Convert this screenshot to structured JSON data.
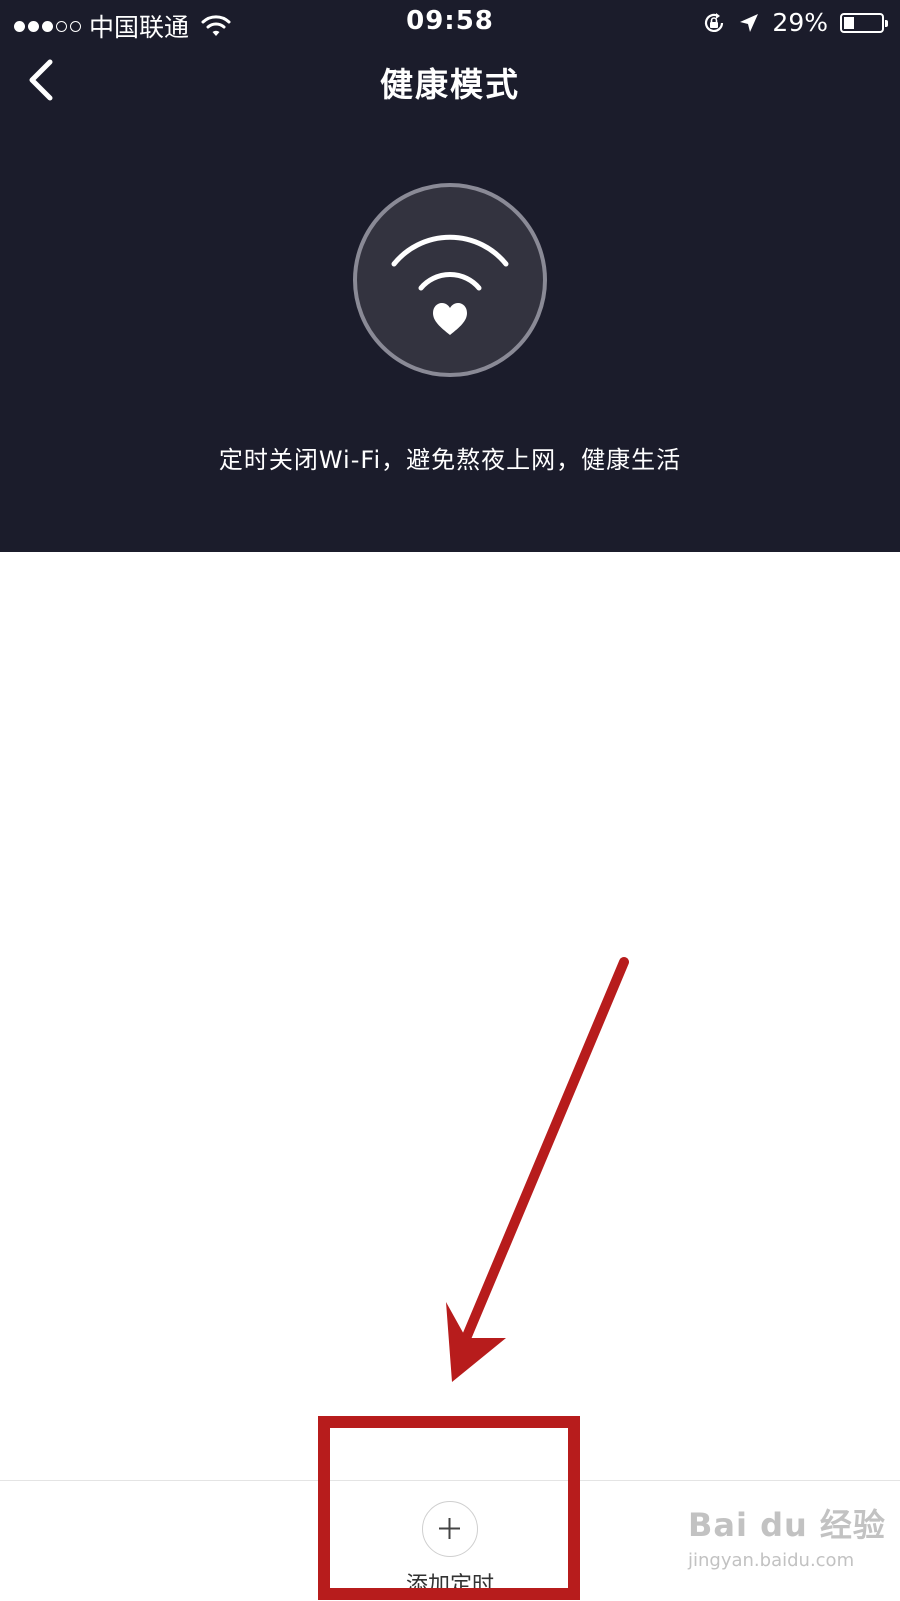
{
  "status_bar": {
    "signal_filled": 3,
    "signal_total": 5,
    "carrier": "中国联通",
    "time": "09:58",
    "battery_percent_text": "29%",
    "battery_level": 0.29,
    "icons": [
      "wifi-icon",
      "rotation-lock-icon",
      "location-arrow-icon",
      "battery-icon"
    ]
  },
  "nav": {
    "back_icon": "chevron-left-icon",
    "title": "健康模式"
  },
  "hero": {
    "icon": "wifi-heart-icon",
    "subtitle": "定时关闭Wi-Fi，避免熬夜上网，健康生活"
  },
  "bottom_bar": {
    "add_icon": "plus-icon",
    "add_label": "添加定时"
  },
  "annotation": {
    "color": "#b71c1c",
    "shapes": [
      "red-arrow",
      "red-highlight-box"
    ]
  },
  "watermark": {
    "brand": "Bai du 经验",
    "url": "jingyan.baidu.com"
  },
  "colors": {
    "header_bg": "#1b1c2b",
    "page_bg": "#ffffff",
    "text_light": "#ffffff"
  }
}
